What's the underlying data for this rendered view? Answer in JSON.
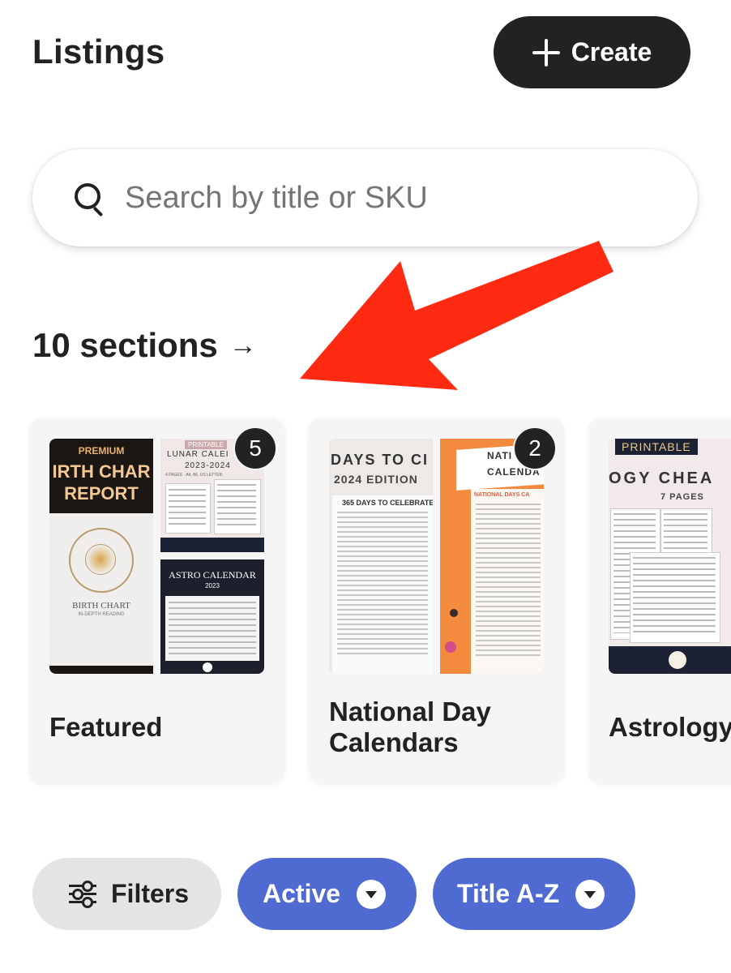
{
  "header": {
    "title": "Listings",
    "create_label": "Create"
  },
  "search": {
    "placeholder": "Search by title or SKU"
  },
  "sections": {
    "link_label": "10 sections",
    "arrow_glyph": "→",
    "cards": [
      {
        "name": "Featured",
        "count": "5",
        "thumbs": {
          "a_tag": "PREMIUM",
          "a_title_1": "IRTH CHAR",
          "a_title_2": "REPORT",
          "a_sub": "BIRTH CHART",
          "a_sub2": "IN-DEPTH READING",
          "b_tag": "PRINTABLE",
          "b_title": "LUNAR CALEI",
          "b_year": "2023-2024",
          "b_sub": "4 PAGES · A4, A5, US LETTER",
          "c_title": "ASTRO CALENDAR",
          "c_year": "2023"
        }
      },
      {
        "name_line1": "National Day",
        "name_line2": "Calendars",
        "count": "2",
        "thumbs": {
          "a_title": "DAYS TO CI",
          "a_edition": "2024 EDITION",
          "a_sub": "365 DAYS TO CELEBRATE",
          "b_title_1": "NATI",
          "b_title_2": "CALENDA",
          "b_sub": "NATIONAL DAYS CA"
        }
      },
      {
        "name": "Astrology",
        "thumbs": {
          "tag": "PRINTABLE",
          "title": "OGY CHEA",
          "sub": "7 PAGES"
        }
      }
    ]
  },
  "filters": {
    "filters_label": "Filters",
    "status_label": "Active",
    "sort_label": "Title A-Z"
  },
  "colors": {
    "accent": "#4f6bd1",
    "dark": "#222222",
    "annotation_arrow": "#ff2a12"
  },
  "icons": {
    "create": "plus-icon",
    "search": "search-icon",
    "sections": "right-arrow-icon",
    "filters": "sliders-icon",
    "dropdown": "dropdown-icon"
  }
}
